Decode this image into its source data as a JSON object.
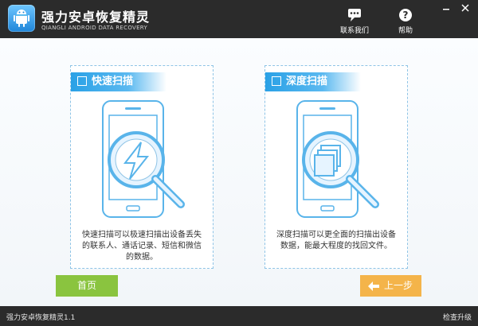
{
  "app": {
    "title": "强力安卓恢复精灵",
    "subtitle": "QIANGLI ANDROID DATA RECOVERY"
  },
  "header": {
    "contact_label": "联系我们",
    "help_label": "帮助"
  },
  "cards": [
    {
      "title": "快速扫描",
      "description": "快速扫描可以极速扫描出设备丢失的联系人、通话记录、短信和微信的数据。",
      "icon": "lightning-icon"
    },
    {
      "title": "深度扫描",
      "description": "深度扫描可以更全面的扫描出设备数据，能最大程度的找回文件。",
      "icon": "stacked-files-icon"
    }
  ],
  "buttons": {
    "home": "首页",
    "prev": "上一步"
  },
  "status": {
    "version": "强力安卓恢复精灵1.1",
    "update": "检查升级"
  },
  "colors": {
    "titlebar": "#2b2b2b",
    "accent_blue": "#2aa1e6",
    "home_green": "#8ac43f",
    "prev_orange": "#f4b44a"
  }
}
